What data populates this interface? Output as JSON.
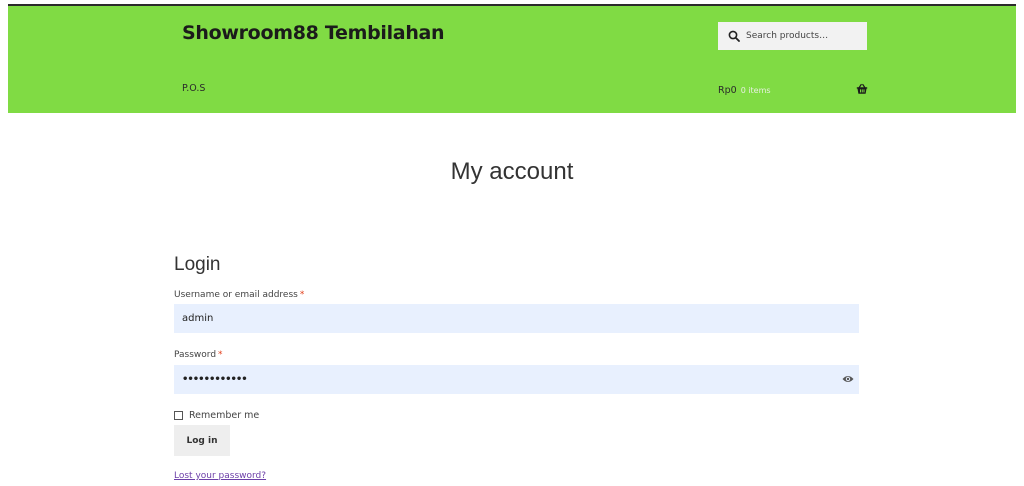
{
  "header": {
    "site_title": "Showroom88 Tembilahan",
    "search": {
      "placeholder": "Search products…",
      "icon": "search-icon"
    },
    "nav": {
      "pos_label": "P.O.S"
    },
    "cart": {
      "amount": "Rp0",
      "count_label": "0 items",
      "icon": "basket-icon"
    },
    "colors": {
      "background": "#80db44",
      "top_border": "#2b2b2b"
    }
  },
  "main": {
    "page_title": "My account",
    "login": {
      "heading": "Login",
      "username": {
        "label": "Username or email address",
        "required_mark": "*",
        "value": "admin"
      },
      "password": {
        "label": "Password",
        "required_mark": "*",
        "value": "••••••••••••",
        "toggle_icon": "eye-icon"
      },
      "remember_label": "Remember me",
      "remember_checked": false,
      "submit_label": "Log in",
      "lost_password_label": "Lost your password?"
    },
    "colors": {
      "input_background": "#e8f0fe",
      "required": "#e2401c",
      "link": "#6c3fa8",
      "button_background": "#eeeeee"
    }
  }
}
